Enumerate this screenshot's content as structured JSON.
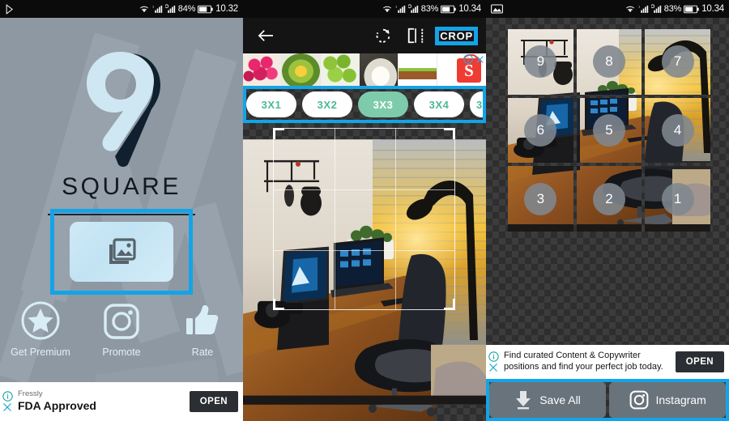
{
  "panels": [
    {
      "id": "splash",
      "statusbar": {
        "left_icon": "play-store-icon",
        "wifi": "wifi-icon",
        "signal1": "signal-bars-icon",
        "signal2": "signal-bars-circle-icon",
        "battery_pct": "84%",
        "battery": "battery-icon",
        "clock": "10.32"
      },
      "logo": {
        "mark": "nine-pin-logo",
        "brand": "SQUARE"
      },
      "picker": {
        "icon": "photo-library-icon",
        "name": "gallery-picker-button"
      },
      "actions": [
        {
          "label": "Get Premium",
          "icon": "star-circle-icon"
        },
        {
          "label": "Promote",
          "icon": "instagram-icon"
        },
        {
          "label": "Rate",
          "icon": "thumb-up-icon"
        }
      ],
      "ad": {
        "advertiser": "Fressly",
        "headline": "FDA Approved",
        "cta": "OPEN",
        "info_icon": "ad-info-icon",
        "close_icon": "ad-close-icon"
      }
    },
    {
      "id": "crop",
      "statusbar": {
        "wifi": "wifi-icon",
        "signal1": "signal-bars-icon",
        "signal2": "signal-bars-circle-icon",
        "battery_pct": "83%",
        "battery": "battery-icon",
        "clock": "10.34"
      },
      "toolbar": {
        "back": "arrow-back-icon",
        "rotate": "rotate-right-icon",
        "flip": "flip-horizontal-icon",
        "crop_label": "CROP"
      },
      "ad": {
        "logo_letter": "S",
        "info_icon": "ad-info-icon",
        "close_icon": "ad-close-icon",
        "thumbnails": [
          "rose-apples-thumbnail",
          "avocado-thumbnail",
          "green-fruit-thumbnail",
          "garlic-thumbnail",
          "snack-pack-thumbnail"
        ]
      },
      "ratios": [
        {
          "label": "3X1",
          "selected": false
        },
        {
          "label": "3X2",
          "selected": false
        },
        {
          "label": "3X3",
          "selected": true
        },
        {
          "label": "3X4",
          "selected": false
        },
        {
          "label": "3",
          "selected": false
        }
      ],
      "canvas": {
        "image": "desk-workspace-photo",
        "grid": "3x3-crop-overlay"
      }
    },
    {
      "id": "result",
      "statusbar": {
        "left_icon": "gallery-image-icon",
        "wifi": "wifi-icon",
        "signal1": "signal-bars-icon",
        "signal2": "signal-bars-circle-icon",
        "battery_pct": "83%",
        "battery": "battery-icon",
        "clock": "10.34"
      },
      "tiles": [
        {
          "number": "9"
        },
        {
          "number": "8"
        },
        {
          "number": "7"
        },
        {
          "number": "6"
        },
        {
          "number": "5"
        },
        {
          "number": "4"
        },
        {
          "number": "3"
        },
        {
          "number": "2"
        },
        {
          "number": "1"
        }
      ],
      "ad": {
        "line1": "Find curated Content & Copywriter",
        "line2": "positions and find your perfect job today.",
        "cta": "OPEN",
        "info_icon": "ad-info-icon",
        "close_icon": "ad-close-icon"
      },
      "buttons": [
        {
          "label": "Save All",
          "icon": "download-icon"
        },
        {
          "label": "Instagram",
          "icon": "instagram-icon"
        }
      ]
    }
  ],
  "colors": {
    "highlight": "#13a4e8",
    "splash_bg": "#8e98a2",
    "accent_light": "#cfe9f6",
    "chip_teal": "#7ecbac",
    "chip_text": "#4cb896",
    "ad_red": "#ef3c32",
    "button_gray": "#69737c"
  }
}
